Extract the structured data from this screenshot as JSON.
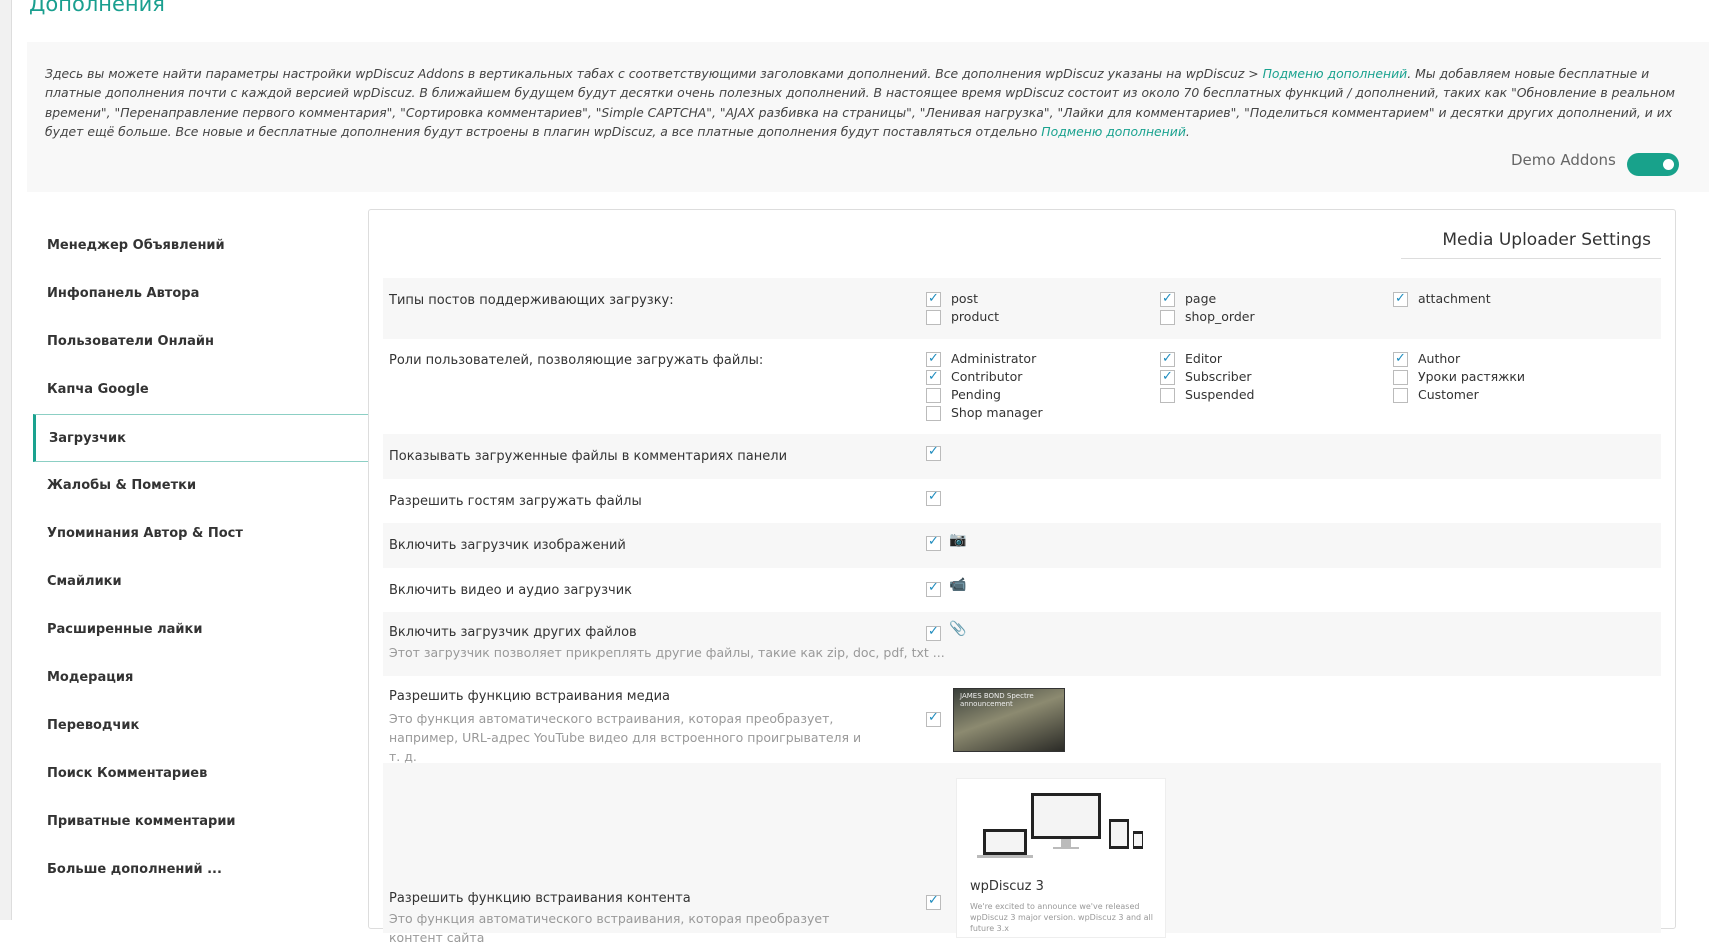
{
  "page_title": "Дополнения",
  "description": {
    "p1": "Здесь вы можете найти параметры настройки wpDiscuz Addons в вертикальных табах с соответствующими заголовками дополнений. Все дополнения wpDiscuz указаны на wpDiscuz > ",
    "link1": "Подменю дополнений",
    "p2": ". Мы добавляем новые бесплатные и платные дополнения почти с каждой версией wpDiscuz. В ближайшем будущем будут десятки очень полезных дополнений. В настоящее время wpDiscuz состоит из около 70 бесплатных функций / дополнений, таких как \"Обновление в реальном времени\", \"Перенаправление первого комментария\", \"Сортировка комментариев\", \"Simple CAPTCHA\", \"AJAX разбивка на страницы\", \"Ленивая нагрузка\", \"Лайки для комментариев\", \"Поделиться комментарием\" и десятки других дополнений, и их будет ещё больше. Все новые и бесплатные дополнения будут встроены в плагин wpDiscuz, а все платные дополнения будут поставляться отдельно ",
    "link2": "Подменю дополнений",
    "p3": "."
  },
  "demo_addons": {
    "label": "Demo Addons",
    "on": true
  },
  "sidebar": [
    "Менеджер Объявлений",
    "Инфопанель Автора",
    "Пользователи Онлайн",
    "Капча Google",
    "Загрузчик",
    "Жалобы & Пометки",
    "Упоминания Автор & Пост",
    "Смайлики",
    "Расширенные лайки",
    "Модерация",
    "Переводчик",
    "Поиск Комментариев",
    "Приватные комментарии",
    "Больше дополнений ..."
  ],
  "active_sidebar": "Загрузчик",
  "panel": {
    "title": "Media Uploader Settings",
    "post_types": {
      "label": "Типы постов поддерживающих загрузку:",
      "options": [
        {
          "name": "post",
          "checked": true
        },
        {
          "name": "page",
          "checked": true
        },
        {
          "name": "attachment",
          "checked": true
        },
        {
          "name": "product",
          "checked": false
        },
        {
          "name": "shop_order",
          "checked": false
        }
      ]
    },
    "roles": {
      "label": "Роли пользователей, позволяющие загружать файлы:",
      "options": [
        {
          "name": "Administrator",
          "checked": true
        },
        {
          "name": "Editor",
          "checked": true
        },
        {
          "name": "Author",
          "checked": true
        },
        {
          "name": "Contributor",
          "checked": true
        },
        {
          "name": "Subscriber",
          "checked": true
        },
        {
          "name": "Уроки растяжки",
          "checked": false
        },
        {
          "name": "Pending",
          "checked": false
        },
        {
          "name": "Suspended",
          "checked": false
        },
        {
          "name": "Customer",
          "checked": false
        },
        {
          "name": "Shop manager",
          "checked": false
        }
      ]
    },
    "show_files": {
      "label": "Показывать загруженные файлы в комментариях панели",
      "checked": true
    },
    "guest_upload": {
      "label": "Разрешить гостям загружать файлы",
      "checked": true
    },
    "image_uploader": {
      "label": "Включить загрузчик изображений",
      "checked": true
    },
    "video_uploader": {
      "label": "Включить видео и аудио загрузчик",
      "checked": true
    },
    "other_uploader": {
      "label": "Включить загрузчик других файлов",
      "sub": "Этот загрузчик позволяет прикреплять другие файлы, такие как zip, doc, pdf, txt ...",
      "checked": true
    },
    "media_embed": {
      "label": "Разрешить функцию встраивания медиа",
      "sub": "Это функция автоматического встраивания, которая преобразует, например, URL-адрес YouTube видео для встроенного проигрывателя и т. д.",
      "checked": true,
      "preview_title": "JAMES BOND Spectre announcement"
    },
    "content_embed": {
      "label": "Разрешить функцию встраивания контента",
      "sub": "Это функция автоматического встраивания, которая преобразует контент сайта",
      "checked": true,
      "card_title": "wpDiscuz 3",
      "card_text": "We're excited to announce we've released wpDiscuz 3 major version. wpDiscuz 3 and all future 3.x"
    }
  }
}
